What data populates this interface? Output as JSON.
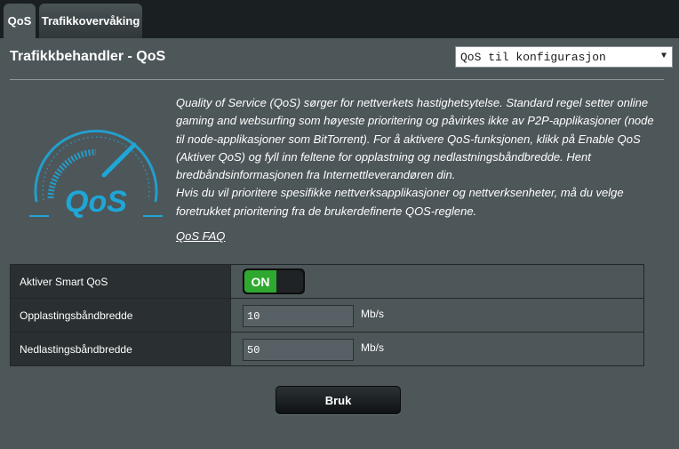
{
  "tabs": [
    {
      "label": "QoS",
      "active": true
    },
    {
      "label": "Trafikkovervåking",
      "active": false
    }
  ],
  "header": {
    "title": "Trafikkbehandler - QoS",
    "select_value": "QoS til konfigurasjon"
  },
  "logo": {
    "text": "QoS",
    "color": "#1fa6d6"
  },
  "description": "Quality of Service (QoS) sørger for nettverkets hastighetsytelse. Standard regel setter online gaming and websurfing som høyeste prioritering og påvirkes ikke av P2P-applikasjoner (node til node-applikasjoner som BitTorrent). For å aktivere QoS-funksjonen, klikk på Enable QoS (Aktiver QoS) og fyll inn feltene for opplastning og nedlastningsbåndbredde. Hent bredbåndsinformasjonen fra Internettleverandøren din.\nHvis du vil prioritere spesifikke nettverksapplikasjoner og nettverksenheter, må du velge foretrukket prioritering fra de brukerdefinerte QOS-reglene.",
  "faq_link": "QoS FAQ",
  "settings": {
    "smart_qos": {
      "label": "Aktiver Smart QoS",
      "toggle_text": "ON",
      "enabled": true
    },
    "upload": {
      "label": "Opplastingsbåndbredde",
      "value": "10",
      "unit": "Mb/s"
    },
    "download": {
      "label": "Nedlastingsbåndbredde",
      "value": "50",
      "unit": "Mb/s"
    }
  },
  "apply_button": "Bruk",
  "colors": {
    "accent_green": "#2fa82f",
    "logo_blue": "#1fa6d6",
    "panel_bg": "#4d5659"
  }
}
